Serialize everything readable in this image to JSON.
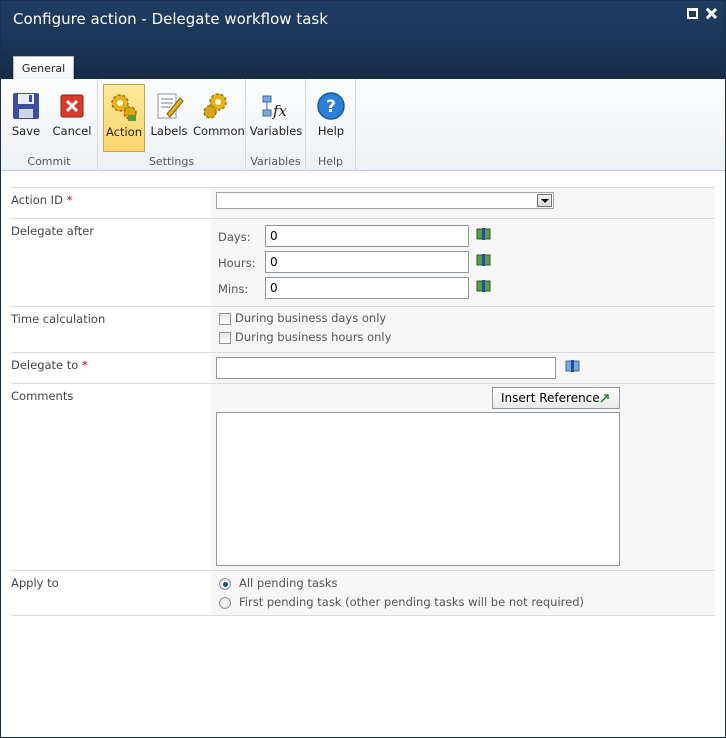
{
  "window": {
    "title": "Configure action - Delegate workflow task"
  },
  "ribbon": {
    "tab": "General",
    "groups": {
      "commit": "Commit",
      "settings": "Settings",
      "variables": "Variables",
      "help": "Help"
    },
    "buttons": {
      "save": "Save",
      "cancel": "Cancel",
      "action": "Action",
      "labels": "Labels",
      "common": "Common",
      "variables": "Variables",
      "help": "Help"
    },
    "active_button": "Action"
  },
  "form": {
    "action_id": {
      "label": "Action ID",
      "required_mark": "*",
      "value": ""
    },
    "delegate_after": {
      "label": "Delegate after",
      "days_label": "Days:",
      "days_value": "0",
      "hours_label": "Hours:",
      "hours_value": "0",
      "mins_label": "Mins:",
      "mins_value": "0"
    },
    "time_calculation": {
      "label": "Time calculation",
      "business_days": "During business days only",
      "business_hours": "During business hours only"
    },
    "delegate_to": {
      "label": "Delegate to",
      "required_mark": "*",
      "value": ""
    },
    "comments": {
      "label": "Comments",
      "insert_reference": "Insert Reference",
      "value": ""
    },
    "apply_to": {
      "label": "Apply to",
      "option_all": "All pending tasks",
      "option_first": "First pending task (other pending tasks will be not required)",
      "selected": "All pending tasks"
    }
  },
  "colors": {
    "titlebar": "#1a3455",
    "active_button": "#fbd56c",
    "required": "#cc0000"
  }
}
